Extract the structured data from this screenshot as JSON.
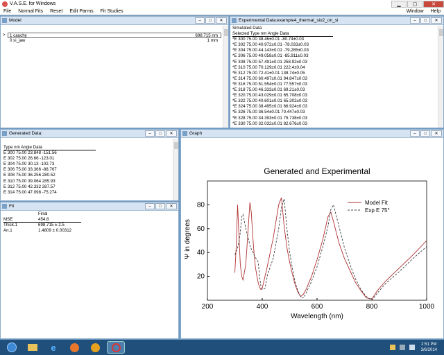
{
  "window": {
    "title": "V.A.S.E. for Windows"
  },
  "menu": {
    "items": [
      "File",
      "Normal Fits",
      "Reset",
      "Edit Parms",
      "Fit Studies"
    ],
    "right_items": [
      "Window",
      "Help"
    ]
  },
  "model": {
    "title": "Model",
    "layers": [
      {
        "marker": ">",
        "name": "1 cauchy",
        "value": "698.715 nm"
      },
      {
        "marker": "",
        "name": "0 si_jaw",
        "value": "1 mm"
      }
    ]
  },
  "experimental": {
    "title": "Experimental Data:example4_thermal_sio2_on_si",
    "subtitle": "Simulated Data",
    "header": "Selected Type  nm  Angle  Data",
    "rows": [
      "*E  300  75.00  38.46±0.01  -80.74±0.03",
      "*E  302  75.00  40.972±0.01  -78.033±0.03",
      "*E  304  75.00  44.143±0.01  -79.285±0.03",
      "*E  306  75.00  49.058±0.01  -85.911±0.03",
      "*E  308  75.00  57.491±0.01  258.92±0.03",
      "*E  310  75.00  70.129±0.01  222.4±0.04",
      "*E  312  75.00  72.41±0.01  138.74±0.05",
      "*E  314  75.00  60.497±0.01  94.847±0.03",
      "*E  316  75.00  51.554±0.01  77.557±0.03",
      "*E  318  75.00  46.333±0.01  69.21±0.03",
      "*E  320  75.00  43.029±0.01  65.708±0.03",
      "*E  322  75.00  40.601±0.01  65.302±0.03",
      "*E  324  75.00  38.495±0.01  66.924±0.03",
      "*E  326  75.00  36.54±0.01  70.447±0.03",
      "*E  328  75.00  34.393±0.01  75.738±0.03",
      "*E  330  75.00  32.032±0.01  82.676±0.03"
    ]
  },
  "generated": {
    "title": "Generated Data:",
    "header": "Type  nm  Angle  Data",
    "rows": [
      "E  300  75.00  23.848  -151.56",
      "E  302  75.00  26.66  -123.01",
      "E  304  75.00  30.13  -102.73",
      "E  306  75.00  33.366  -88.767",
      "E  308  75.00  36.256  280.52",
      "E  310  75.00  39.064  285.93",
      "E  312  75.00  42.332  287.57",
      "E  314  75.00  47.098  -75.274"
    ]
  },
  "fit": {
    "title": "Fit",
    "col_header": "Final",
    "rows": [
      {
        "label": "MSE",
        "value": "454.8"
      },
      {
        "label": "Thick.1",
        "value": "698.715 ± 2.5"
      },
      {
        "label": "An.1",
        "value": "1.4809 ± 0.00312"
      }
    ]
  },
  "graph": {
    "title": "Graph"
  },
  "chart_data": {
    "type": "line",
    "title": "Generated and Experimental",
    "xlabel": "Wavelength (nm)",
    "ylabel": "Ψ in degrees",
    "xlim": [
      200,
      1000
    ],
    "ylim": [
      0,
      100
    ],
    "xticks": [
      200,
      400,
      600,
      800,
      1000
    ],
    "yticks": [
      20,
      40,
      60,
      80
    ],
    "legend_position": "top-right",
    "series": [
      {
        "name": "Model Fit",
        "style": "solid",
        "color": "#b03030",
        "x": [
          300,
          305,
          310,
          315,
          320,
          325,
          330,
          340,
          350,
          355,
          360,
          365,
          370,
          375,
          380,
          385,
          390,
          395,
          400,
          410,
          420,
          440,
          460,
          470,
          480,
          490,
          500,
          510,
          520,
          530,
          540,
          550,
          560,
          580,
          600,
          620,
          640,
          650,
          660,
          680,
          700,
          720,
          740,
          760,
          780,
          800,
          820,
          850,
          900,
          950,
          1000
        ],
        "y": [
          23,
          45,
          80,
          55,
          30,
          20,
          17,
          30,
          65,
          82,
          74,
          55,
          40,
          28,
          21,
          15,
          11,
          9,
          10,
          20,
          30,
          52,
          80,
          86,
          62,
          44,
          32,
          22,
          13,
          7,
          3,
          5,
          9,
          20,
          34,
          50,
          70,
          74,
          66,
          48,
          35,
          25,
          15,
          8,
          2,
          1,
          8,
          16,
          27,
          38,
          50
        ]
      },
      {
        "name": "Exp E 75°",
        "style": "dashed",
        "color": "#404040",
        "x": [
          300,
          305,
          310,
          315,
          320,
          325,
          330,
          340,
          350,
          355,
          360,
          365,
          370,
          375,
          380,
          385,
          390,
          395,
          400,
          410,
          420,
          440,
          460,
          470,
          480,
          490,
          500,
          510,
          520,
          530,
          540,
          550,
          560,
          580,
          600,
          620,
          640,
          650,
          660,
          680,
          700,
          720,
          740,
          760,
          780,
          800,
          820,
          850,
          900,
          950,
          1000
        ],
        "y": [
          38,
          41,
          44,
          49,
          57,
          70,
          72,
          60,
          51,
          46,
          43,
          41,
          38,
          36,
          34,
          32,
          21,
          12,
          9,
          10,
          22,
          35,
          60,
          78,
          85,
          60,
          40,
          27,
          15,
          8,
          3,
          2,
          6,
          16,
          28,
          44,
          62,
          76,
          80,
          62,
          44,
          30,
          18,
          9,
          3,
          0,
          6,
          14,
          24,
          35,
          45
        ]
      }
    ]
  },
  "taskbar": {
    "time": "2:51 PM",
    "date": "3/6/2014"
  }
}
